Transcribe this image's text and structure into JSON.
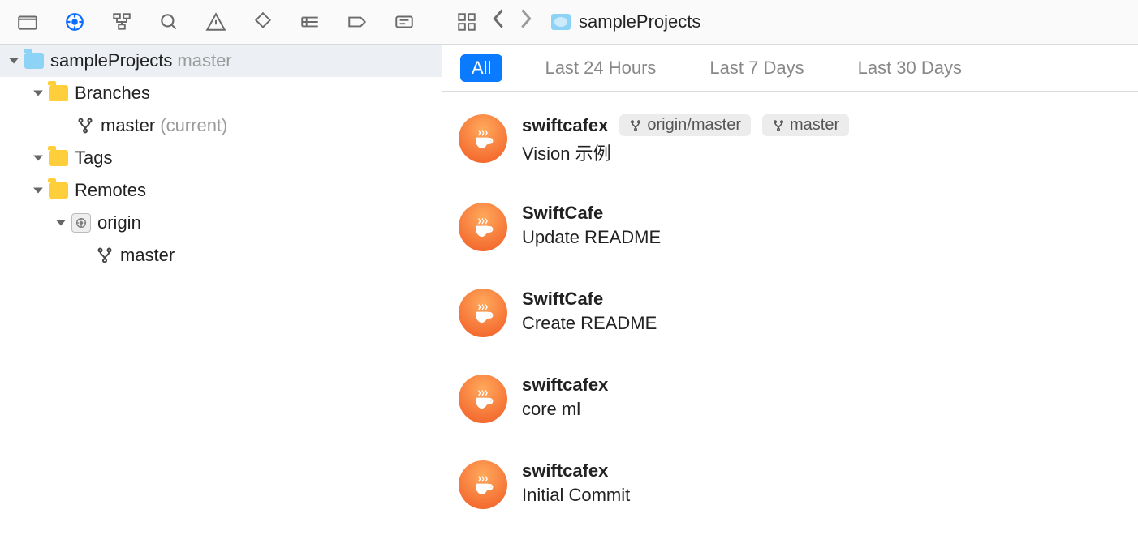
{
  "project": {
    "name": "sampleProjects",
    "branch": "master"
  },
  "sidebar": {
    "root": {
      "name": "sampleProjects",
      "branchLabel": "master"
    },
    "branches": {
      "label": "Branches",
      "items": [
        {
          "name": "master",
          "suffix": "(current)"
        }
      ]
    },
    "tags": {
      "label": "Tags"
    },
    "remotes": {
      "label": "Remotes",
      "items": [
        {
          "name": "origin",
          "branches": [
            {
              "name": "master"
            }
          ]
        }
      ]
    }
  },
  "filters": {
    "items": [
      "All",
      "Last 24 Hours",
      "Last 7 Days",
      "Last 30 Days"
    ],
    "activeIndex": 0
  },
  "commits": [
    {
      "author": "swiftcafex",
      "message": "Vision 示例",
      "badges": [
        "origin/master",
        "master"
      ]
    },
    {
      "author": "SwiftCafe",
      "message": "Update README",
      "badges": []
    },
    {
      "author": "SwiftCafe",
      "message": "Create README",
      "badges": []
    },
    {
      "author": "swiftcafex",
      "message": "core ml",
      "badges": []
    },
    {
      "author": "swiftcafex",
      "message": "Initial Commit",
      "badges": []
    }
  ]
}
